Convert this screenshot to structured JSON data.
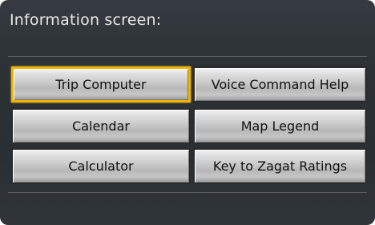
{
  "screen": {
    "title": "Information screen:"
  },
  "buttons": {
    "trip_computer": "Trip Computer",
    "voice_command_help": "Voice Command Help",
    "calendar": "Calendar",
    "map_legend": "Map Legend",
    "calculator": "Calculator",
    "zagat_key": "Key to Zagat Ratings"
  },
  "colors": {
    "background": "#2c3135",
    "selection_border": "#f0b400",
    "button_text": "#111111",
    "title_text": "#e8e8e8"
  }
}
